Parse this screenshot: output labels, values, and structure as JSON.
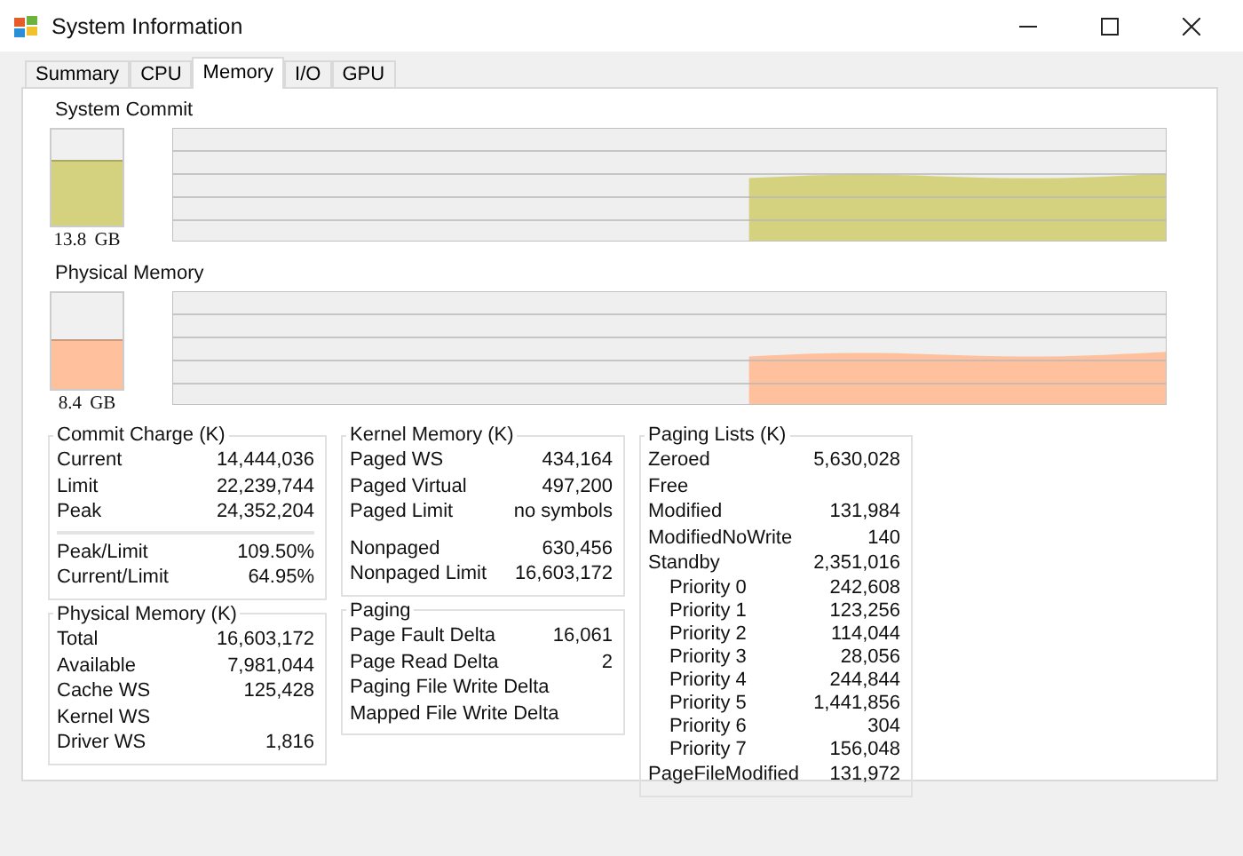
{
  "window": {
    "title": "System Information"
  },
  "tabs": [
    {
      "label": "Summary",
      "selected": false
    },
    {
      "label": "CPU",
      "selected": false
    },
    {
      "label": "Memory",
      "selected": true
    },
    {
      "label": "I/O",
      "selected": false
    },
    {
      "label": "GPU",
      "selected": false
    }
  ],
  "meters": [
    {
      "label": "System Commit",
      "level": 0.68,
      "reading": "13.8 GB",
      "color": "#d4d27e"
    },
    {
      "label": "Physical Memory",
      "level": 0.52,
      "reading": "8.4 GB",
      "color": "#ffc09e"
    }
  ],
  "columns": [
    [
      {
        "title": "Commit Charge (K)",
        "divider": true,
        "sections": [
          [
            {
              "label": "Current",
              "value": "14,444,036"
            },
            {
              "label": "Limit",
              "value": "22,239,744"
            },
            {
              "label": "Peak",
              "value": "24,352,204"
            }
          ],
          [
            {
              "label": "Peak/Limit",
              "value": "109.50%"
            },
            {
              "label": "Current/Limit",
              "value": "64.95%"
            }
          ]
        ]
      },
      {
        "title": "Physical Memory (K)",
        "sections": [
          [
            {
              "label": "Total",
              "value": "16,603,172"
            },
            {
              "label": "Available",
              "value": "7,981,044"
            },
            {
              "label": "Cache WS",
              "value": "125,428"
            },
            {
              "label": "Kernel WS"
            },
            {
              "label": "Driver WS",
              "value": "1,816"
            }
          ]
        ]
      }
    ],
    [
      {
        "title": "Kernel Memory (K)",
        "divider": false,
        "sections": [
          [
            {
              "label": "Paged WS",
              "value": "434,164"
            },
            {
              "label": "Paged Virtual",
              "value": "497,200"
            },
            {
              "label": "Paged Limit",
              "value": "no symbols"
            }
          ],
          [
            {
              "label": "Nonpaged",
              "value": "630,456"
            },
            {
              "label": "Nonpaged Limit",
              "value": "16,603,172"
            }
          ]
        ]
      },
      {
        "title": "Paging",
        "sections": [
          [
            {
              "label": "Page Fault Delta",
              "value": "16,061"
            },
            {
              "label": "Page Read Delta",
              "value": "2"
            },
            {
              "label": "Paging File Write Delta"
            },
            {
              "label": "Mapped File Write Delta"
            }
          ]
        ]
      }
    ],
    [
      {
        "title": "Paging Lists (K)",
        "sections": [
          [
            {
              "label": "Zeroed",
              "value": "5,630,028"
            },
            {
              "label": "Free"
            },
            {
              "label": "Modified",
              "value": "131,984"
            },
            {
              "label": "ModifiedNoWrite",
              "value": "140"
            },
            {
              "label": "Standby",
              "value": "2,351,016",
              "children": [
                {
                  "label": "Priority 0",
                  "value": "242,608"
                },
                {
                  "label": "Priority 1",
                  "value": "123,256"
                },
                {
                  "label": "Priority 2",
                  "value": "114,044"
                },
                {
                  "label": "Priority 3",
                  "value": "28,056"
                },
                {
                  "label": "Priority 4",
                  "value": "244,844"
                },
                {
                  "label": "Priority 5",
                  "value": "1,441,856"
                },
                {
                  "label": "Priority 6",
                  "value": "304"
                },
                {
                  "label": "Priority 7",
                  "value": "156,048"
                }
              ]
            },
            {
              "label": "PageFileModified",
              "value": "131,972"
            }
          ]
        ]
      }
    ]
  ]
}
